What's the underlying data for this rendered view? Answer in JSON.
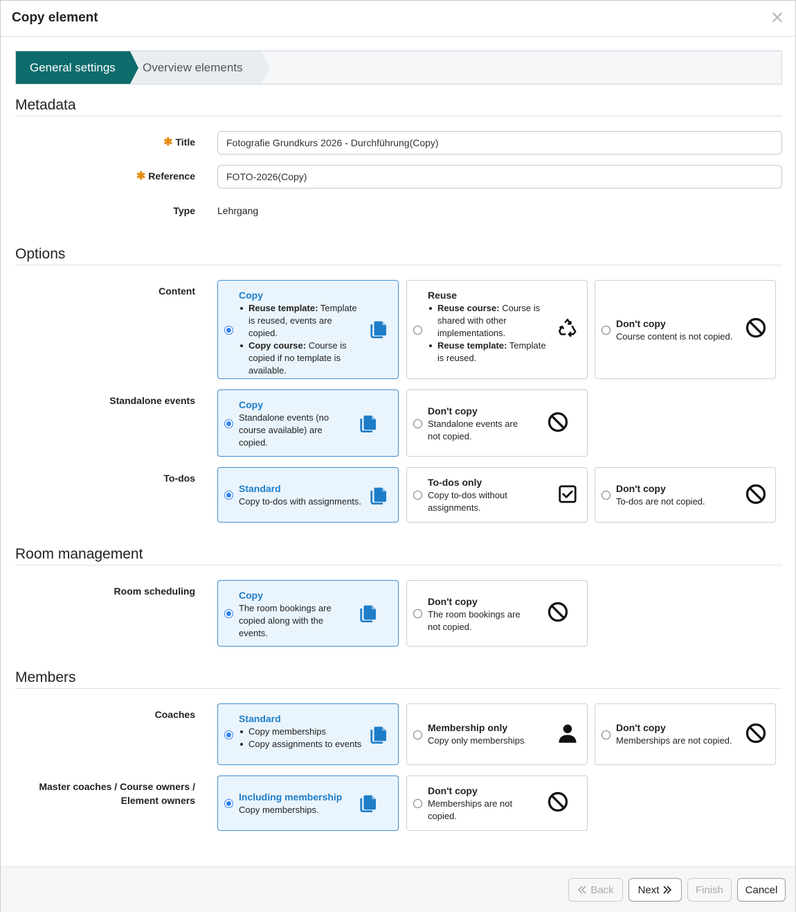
{
  "dialog": {
    "title": "Copy element"
  },
  "wizard": {
    "steps": [
      {
        "label": "General settings",
        "active": true
      },
      {
        "label": "Overview elements",
        "active": false
      }
    ]
  },
  "metadata": {
    "heading": "Metadata",
    "title_label": "Title",
    "title_value": "Fotografie Grundkurs 2026 - Durchführung(Copy)",
    "reference_label": "Reference",
    "reference_value": "FOTO-2026(Copy)",
    "type_label": "Type",
    "type_value": "Lehrgang",
    "required_mark": "✱"
  },
  "options": {
    "heading": "Options",
    "content": {
      "label": "Content",
      "cards": [
        {
          "title": "Copy",
          "selected": true,
          "icon": "copy-icon",
          "bullets": [
            {
              "bold": "Reuse template:",
              "text": " Template is reused, events are copied."
            },
            {
              "bold": "Copy course:",
              "text": " Course is copied if no template is available."
            }
          ]
        },
        {
          "title": "Reuse",
          "selected": false,
          "icon": "recycle-icon",
          "bullets": [
            {
              "bold": "Reuse course:",
              "text": " Course is shared with other implementations."
            },
            {
              "bold": "Reuse template:",
              "text": " Template is reused."
            }
          ]
        },
        {
          "title": "Don't copy",
          "selected": false,
          "icon": "ban-icon",
          "text": "Course content is not copied."
        }
      ]
    },
    "standalone": {
      "label": "Standalone events",
      "cards": [
        {
          "title": "Copy",
          "selected": true,
          "icon": "copy-icon",
          "text": "Standalone events (no course available) are copied."
        },
        {
          "title": "Don't copy",
          "selected": false,
          "icon": "ban-icon",
          "text": "Standalone events are not copied."
        }
      ]
    },
    "todos": {
      "label": "To-dos",
      "cards": [
        {
          "title": "Standard",
          "selected": true,
          "icon": "copy-icon",
          "text": "Copy to-dos with assignments."
        },
        {
          "title": "To-dos only",
          "selected": false,
          "icon": "checkbox-icon",
          "text": "Copy to-dos without assignments."
        },
        {
          "title": "Don't copy",
          "selected": false,
          "icon": "ban-icon",
          "text": "To-dos are not copied."
        }
      ]
    }
  },
  "rooms": {
    "heading": "Room management",
    "scheduling": {
      "label": "Room scheduling",
      "cards": [
        {
          "title": "Copy",
          "selected": true,
          "icon": "copy-icon",
          "text": "The room bookings are copied along with the events."
        },
        {
          "title": "Don't copy",
          "selected": false,
          "icon": "ban-icon",
          "text": "The room bookings are not copied."
        }
      ]
    }
  },
  "members": {
    "heading": "Members",
    "coaches": {
      "label": "Coaches",
      "cards": [
        {
          "title": "Standard",
          "selected": true,
          "icon": "copy-icon",
          "bullets": [
            {
              "bold": "",
              "text": "Copy memberships"
            },
            {
              "bold": "",
              "text": "Copy assignments to events"
            }
          ]
        },
        {
          "title": "Membership only",
          "selected": false,
          "icon": "user-icon",
          "text": "Copy only memberships"
        },
        {
          "title": "Don't copy",
          "selected": false,
          "icon": "ban-icon",
          "text": "Memberships are not copied."
        }
      ]
    },
    "owners": {
      "label_line1": "Master coaches / Course owners /",
      "label_line2": "Element owners",
      "cards": [
        {
          "title": "Including membership",
          "selected": true,
          "icon": "copy-icon",
          "text": "Copy memberships."
        },
        {
          "title": "Don't copy",
          "selected": false,
          "icon": "ban-icon",
          "text": "Memberships are not copied."
        }
      ]
    }
  },
  "footer": {
    "back": "Back",
    "next": "Next",
    "finish": "Finish",
    "cancel": "Cancel"
  },
  "colors": {
    "accent": "#0e6b6b",
    "selected_border": "#3d8fd6",
    "selected_bg": "#eaf4fc",
    "link_blue": "#1e7dc8",
    "required": "#e38b10"
  }
}
